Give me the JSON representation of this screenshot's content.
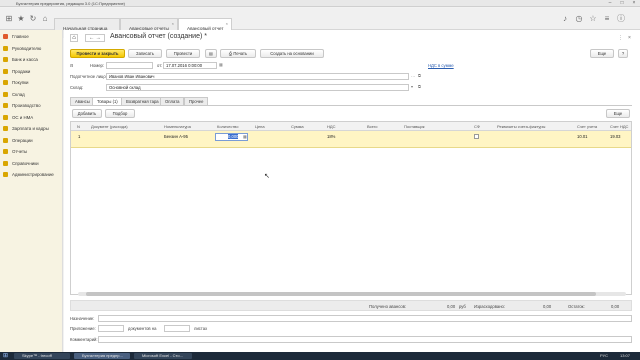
{
  "window": {
    "title": "Бухгалтерия предприятия, редакция 3.0 (1С:Предприятие)"
  },
  "tabs": [
    {
      "label": "Начальная страница"
    },
    {
      "label": "Авансовые отчеты"
    },
    {
      "label": "Авансовый отчет (создание) *"
    }
  ],
  "sidebar": {
    "items": [
      {
        "label": "Главное",
        "color": "#e05a2a"
      },
      {
        "label": "Руководителю",
        "color": "#d9a600"
      },
      {
        "label": "Банк и касса",
        "color": "#d9a600"
      },
      {
        "label": "Продажи",
        "color": "#d9a600"
      },
      {
        "label": "Покупки",
        "color": "#d9a600"
      },
      {
        "label": "Склад",
        "color": "#d9a600"
      },
      {
        "label": "Производство",
        "color": "#d9a600"
      },
      {
        "label": "ОС и НМА",
        "color": "#d9a600"
      },
      {
        "label": "Зарплата и кадры",
        "color": "#d9a600"
      },
      {
        "label": "Операции",
        "color": "#d9a600"
      },
      {
        "label": "Отчеты",
        "color": "#d9a600"
      },
      {
        "label": "Справочники",
        "color": "#d9a600"
      },
      {
        "label": "Администрирование",
        "color": "#d9a600"
      }
    ]
  },
  "doc": {
    "title": "Авансовый отчет (создание) *",
    "buttons": {
      "post_close": "Провести и закрыть",
      "save": "Записать",
      "post": "Провести",
      "print": "Печать",
      "create_based": "Создать на основании",
      "more": "Еще",
      "help": "?"
    },
    "number_label": "Номер:",
    "number_value": "",
    "date_from": "от:",
    "date_value": "17.07.2016  0:00:00",
    "vat_link": "НДС в сумме",
    "person_label": "Подотчетное лицо:",
    "person_value": "Иванов Иван Иванович",
    "warehouse_label": "Склад:",
    "warehouse_value": "Основной склад",
    "form_tabs": [
      "Авансы",
      "Товары (1)",
      "Возвратная тара",
      "Оплата",
      "Прочее"
    ],
    "add_button": "Добавить",
    "select_button": "Подбор",
    "table_more": "Еще",
    "columns": [
      "N",
      "Документ (расхода)",
      "Номенклатура",
      "Количество",
      "Цена",
      "Сумма",
      "НДС",
      "Всего",
      "Поставщик",
      "СФ",
      "Реквизиты счета-фактуры",
      "Счет учета",
      "Счет НДС"
    ],
    "rows": [
      {
        "n": "1",
        "doc": "",
        "item": "Бензин А-95",
        "qty": "0,000",
        "price": "",
        "sum": "",
        "vat": "18%",
        "total": "",
        "supplier": "",
        "sf": "",
        "invoice": "",
        "account": "10.01",
        "vat_account": "19.03"
      }
    ],
    "totals": {
      "received_label": "Получено авансов:",
      "received_value": "0,00",
      "currency": "руб",
      "spent_label": "Израсходовано:",
      "spent_value": "0,00",
      "balance_label": "Остаток:",
      "balance_value": "0,00"
    },
    "purpose_label": "Назначение:",
    "attach_label": "Приложение:",
    "docs_on": "документов на",
    "sheets": "листах",
    "comment_label": "Комментарий:"
  },
  "taskbar": {
    "items": [
      "Skype™ - trecoff",
      "Бухгалтерия предпр...",
      "Microsoft Excel - Сто..."
    ],
    "lang": "РУС",
    "time": "13:07"
  }
}
